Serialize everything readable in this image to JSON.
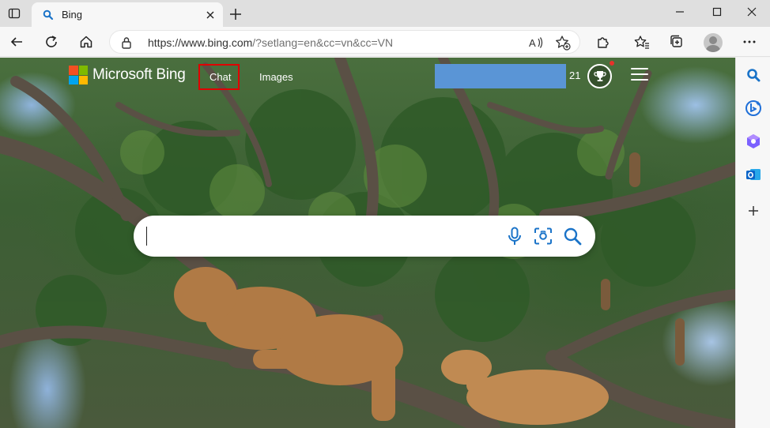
{
  "browser": {
    "tab": {
      "title": "Bing"
    },
    "address_bar": {
      "url_host": "https://www.bing.com",
      "url_rest": "/?setlang=en&cc=vn&cc=VN"
    },
    "icons": {
      "tab_actions": "tab-actions-icon",
      "favicon": "bing-search-favicon",
      "close_tab": "close-icon",
      "new_tab": "plus-icon",
      "minimize": "minimize-icon",
      "maximize": "maximize-icon",
      "close_window": "close-icon",
      "back": "back-arrow-icon",
      "refresh": "refresh-icon",
      "home": "home-icon",
      "lock": "lock-icon",
      "read_aloud": "read-aloud-icon",
      "add_favorite": "add-favorite-icon",
      "extensions": "puzzle-icon",
      "favorites": "favorites-icon",
      "collections": "collections-icon",
      "profile": "profile-avatar",
      "more": "more-icon"
    }
  },
  "bing": {
    "brand": "Microsoft Bing",
    "nav": {
      "chat": "Chat",
      "images": "Images"
    },
    "rewards_points": "21",
    "search": {
      "value": ""
    },
    "colors": {
      "ms_red": "#f25022",
      "ms_green": "#7fba00",
      "ms_blue": "#00a4ef",
      "ms_yellow": "#ffb900",
      "icon_blue": "#1a73c8",
      "highlight_red": "#e00000"
    }
  },
  "sidebar": {
    "items": [
      "search-icon",
      "copilot-icon",
      "games-icon",
      "outlook-icon",
      "add-icon"
    ]
  }
}
